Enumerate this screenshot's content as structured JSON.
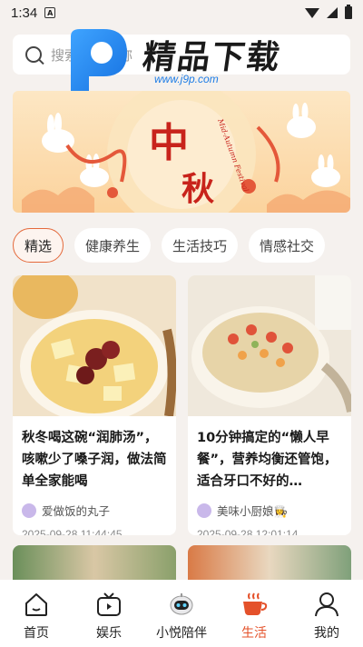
{
  "status_bar": {
    "time": "1:34",
    "notif_badge": "A"
  },
  "search": {
    "placeholder": "搜索文章名称"
  },
  "watermark": {
    "title": "精品下载",
    "url": "www.j9p.com"
  },
  "banner": {
    "main_text_1": "中",
    "main_text_2": "秋",
    "sub_text": "Mid-Autumn Festival"
  },
  "tabs": [
    {
      "label": "精选",
      "active": true
    },
    {
      "label": "健康养生",
      "active": false
    },
    {
      "label": "生活技巧",
      "active": false
    },
    {
      "label": "情感社交",
      "active": false
    }
  ],
  "articles": [
    {
      "title": "秋冬喝这碗“润肺汤”，咳嗽少了嗓子润，做法简单全家能喝",
      "author": "爱做饭的丸子",
      "date": "2025-09-28 11:44:45"
    },
    {
      "title": "10分钟搞定的“懒人早餐”，营养均衡还管饱，适合牙口不好的…",
      "author": "美味小厨娘👩‍🍳",
      "date": "2025-09-28 12:01:14"
    }
  ],
  "bottom_nav": [
    {
      "label": "首页",
      "icon": "home-icon",
      "active": false
    },
    {
      "label": "娱乐",
      "icon": "tv-icon",
      "active": false
    },
    {
      "label": "小悦陪伴",
      "icon": "robot-icon",
      "active": false
    },
    {
      "label": "生活",
      "icon": "cup-icon",
      "active": true
    },
    {
      "label": "我的",
      "icon": "user-icon",
      "active": false
    }
  ],
  "colors": {
    "accent": "#e4512a",
    "tab_border": "#e46a3c",
    "background": "#f5f1ee"
  }
}
